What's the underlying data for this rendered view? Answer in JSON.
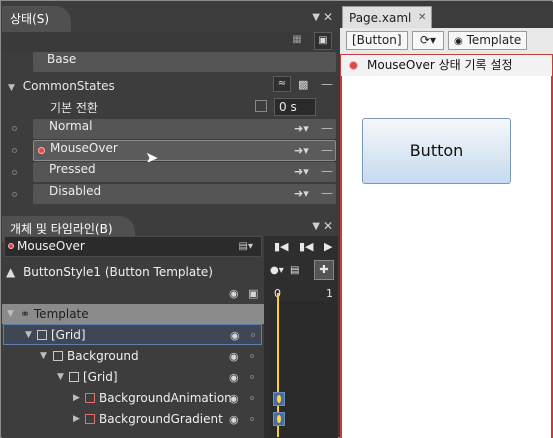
{
  "states_panel": {
    "title": "상태(S)",
    "base_label": "Base",
    "group_name": "CommonStates",
    "default_transition_label": "기본 전환",
    "default_transition_value": "0 s",
    "states": [
      {
        "label": "Normal",
        "recording": false
      },
      {
        "label": "MouseOver",
        "recording": true
      },
      {
        "label": "Pressed",
        "recording": false
      },
      {
        "label": "Disabled",
        "recording": false
      }
    ]
  },
  "objects_panel": {
    "title": "개체 및 타임라인(B)",
    "timeline_name": "MouseOver",
    "style_header": "ButtonStyle1 (Button Template)",
    "tree_root": "Template",
    "tree": [
      {
        "label": "[Grid]",
        "selected": true
      },
      {
        "label": "Background",
        "selected": false
      },
      {
        "label": "[Grid]",
        "selected": false
      },
      {
        "label": "BackgroundAnimation",
        "selected": false
      },
      {
        "label": "BackgroundGradient",
        "selected": false
      }
    ],
    "timeline_ticks": [
      "0",
      "1"
    ]
  },
  "document": {
    "tab_label": "Page.xaml",
    "breadcrumb_button": "[Button]",
    "breadcrumb_template": "Template",
    "recording_label": "MouseOver 상태 기록 설정",
    "preview_button_label": "Button"
  },
  "colors": {
    "record_red": "#e04848",
    "timeline_playhead": "#ffcc33",
    "selection_blue": "#5e7fb0"
  }
}
